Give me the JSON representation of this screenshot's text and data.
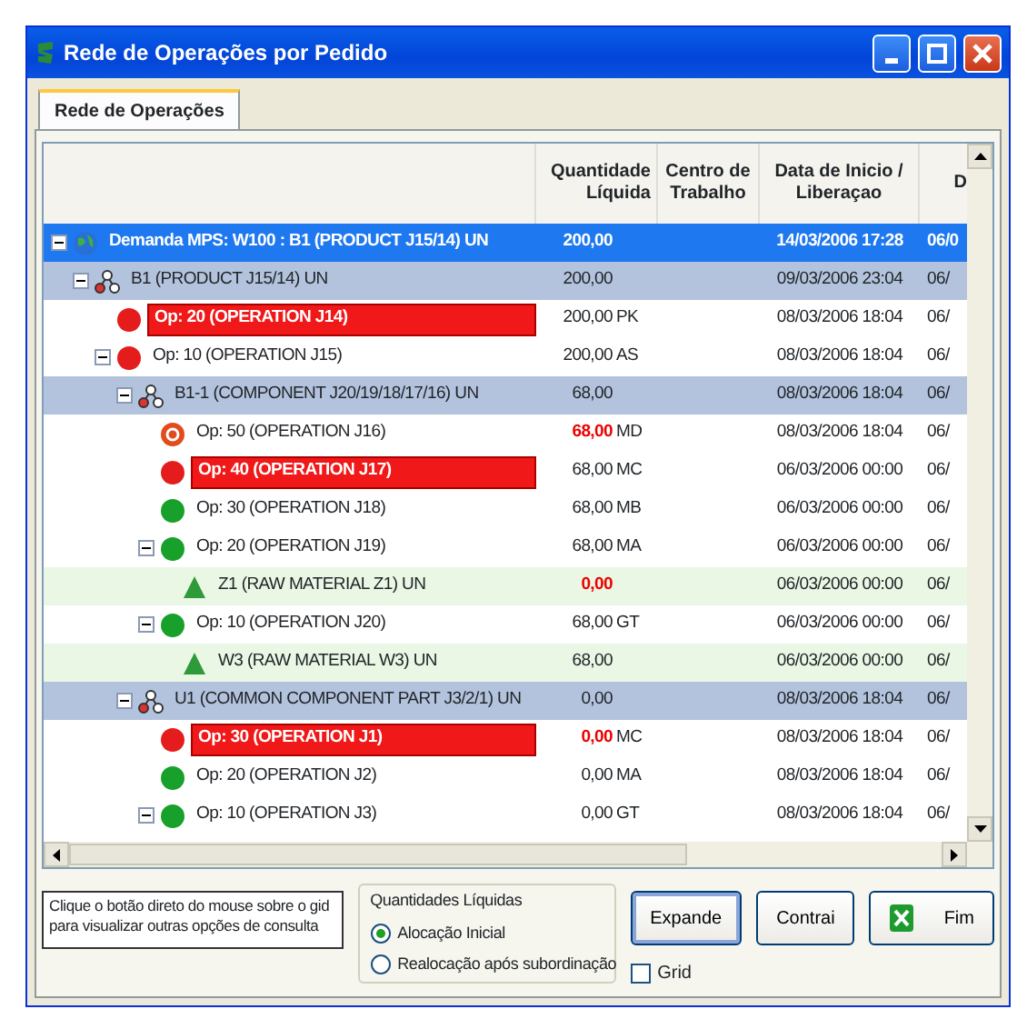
{
  "window": {
    "title": "Rede de Operações por Pedido"
  },
  "tabs": [
    {
      "label": "Rede de Operações",
      "selected": true
    }
  ],
  "grid": {
    "columns": [
      "Quantidade Líquida",
      "Centro de Trabalho",
      "Data de Inicio / Liberaçao",
      "D"
    ],
    "rows": [
      {
        "kind": "demand",
        "label": "Demanda MPS: W100 : B1 (PRODUCT J15/14) UN",
        "qty": "200,00",
        "qty_alert": false,
        "date": "14/03/2006 17:28",
        "column_5": "06/0",
        "selected": true,
        "expanded": true,
        "children": [
          {
            "kind": "assembly",
            "label": "B1 (PRODUCT J15/14) UN",
            "qty": "200,00",
            "qty_alert": false,
            "date": "09/03/2006 23:04",
            "column_5": "06/",
            "selected": false,
            "expanded": true,
            "children": [
              {
                "kind": "late",
                "highlighted": true,
                "label": "Op: 20 (OPERATION J14)",
                "qty": "200,00",
                "code": "PK",
                "qty_alert": false,
                "date": "08/03/2006 18:04",
                "column_5": "06/",
                "selected": false
              },
              {
                "kind": "late",
                "highlighted": false,
                "label": "Op: 10 (OPERATION J15)",
                "qty": "200,00",
                "code": "AS",
                "qty_alert": false,
                "date": "08/03/2006 18:04",
                "column_5": "06/",
                "selected": false,
                "expanded": true,
                "children": [
                  {
                    "kind": "assembly",
                    "label": "B1-1 (COMPONENT J20/19/18/17/16) UN",
                    "qty": "68,00",
                    "qty_alert": false,
                    "date": "08/03/2006 18:04",
                    "column_5": "06/",
                    "selected": false,
                    "expanded": true,
                    "children": [
                      {
                        "kind": "warning",
                        "highlighted": false,
                        "label": "Op: 50 (OPERATION J16)",
                        "qty": "68,00",
                        "code": "MD",
                        "qty_alert": true,
                        "date": "08/03/2006 18:04",
                        "column_5": "06/",
                        "selected": false
                      },
                      {
                        "kind": "late",
                        "highlighted": true,
                        "label": "Op: 40 (OPERATION J17)",
                        "qty": "68,00",
                        "code": "MC",
                        "qty_alert": false,
                        "date": "06/03/2006 00:00",
                        "column_5": "06/",
                        "selected": false
                      },
                      {
                        "kind": "ok",
                        "highlighted": false,
                        "label": "Op: 30 (OPERATION J18)",
                        "qty": "68,00",
                        "code": "MB",
                        "qty_alert": false,
                        "date": "06/03/2006 00:00",
                        "column_5": "06/",
                        "selected": false
                      },
                      {
                        "kind": "ok",
                        "highlighted": false,
                        "label": "Op: 20 (OPERATION J19)",
                        "qty": "68,00",
                        "code": "MA",
                        "qty_alert": false,
                        "date": "06/03/2006 00:00",
                        "column_5": "06/",
                        "selected": false,
                        "expanded": true,
                        "children": [
                          {
                            "kind": "material",
                            "label": "Z1 (RAW MATERIAL Z1) UN",
                            "qty": "0,00",
                            "qty_alert": true,
                            "date": "06/03/2006 00:00",
                            "column_5": "06/",
                            "selected": false
                          }
                        ]
                      },
                      {
                        "kind": "ok",
                        "highlighted": false,
                        "label": "Op: 10 (OPERATION J20)",
                        "qty": "68,00",
                        "code": "GT",
                        "qty_alert": false,
                        "date": "06/03/2006 00:00",
                        "column_5": "06/",
                        "selected": false,
                        "expanded": true,
                        "children": [
                          {
                            "kind": "material",
                            "label": "W3 (RAW MATERIAL W3) UN",
                            "qty": "68,00",
                            "qty_alert": false,
                            "date": "06/03/2006 00:00",
                            "column_5": "06/",
                            "selected": false
                          }
                        ]
                      }
                    ]
                  },
                  {
                    "kind": "assembly",
                    "label": "U1 (COMMON COMPONENT PART J3/2/1) UN",
                    "qty": "0,00",
                    "qty_alert": false,
                    "date": "08/03/2006 18:04",
                    "column_5": "06/",
                    "selected": false,
                    "expanded": true,
                    "children": [
                      {
                        "kind": "late",
                        "highlighted": true,
                        "label": "Op: 30 (OPERATION J1)",
                        "qty": "0,00",
                        "code": "MC",
                        "qty_alert": true,
                        "date": "08/03/2006 18:04",
                        "column_5": "06/",
                        "selected": false
                      },
                      {
                        "kind": "ok",
                        "highlighted": false,
                        "label": "Op: 20 (OPERATION J2)",
                        "qty": "0,00",
                        "code": "MA",
                        "qty_alert": false,
                        "date": "08/03/2006 18:04",
                        "column_5": "06/",
                        "selected": false
                      },
                      {
                        "kind": "ok",
                        "highlighted": false,
                        "label": "Op: 10 (OPERATION J3)",
                        "qty": "0,00",
                        "code": "GT",
                        "qty_alert": false,
                        "date": "08/03/2006 18:04",
                        "column_5": "06/",
                        "selected": false,
                        "expanded": true
                      }
                    ]
                  }
                ]
              }
            ]
          }
        ]
      }
    ]
  },
  "hint": "Clique o botão direto do mouse sobre o gid para visualizar outras opções de consulta",
  "quantities": {
    "title": "Quantidades Líquidas",
    "options": [
      {
        "label": "Alocação Inicial",
        "selected": true
      },
      {
        "label": "Realocação após subordinação",
        "selected": false
      }
    ]
  },
  "buttons": [
    {
      "kind": "expand",
      "label": "Expande",
      "default": true
    },
    {
      "kind": "collapse",
      "label": "Contrai",
      "default": false
    },
    {
      "kind": "close",
      "label": "Fim",
      "default": false
    }
  ],
  "grid_checkbox": {
    "label": "Grid",
    "checked": false
  }
}
